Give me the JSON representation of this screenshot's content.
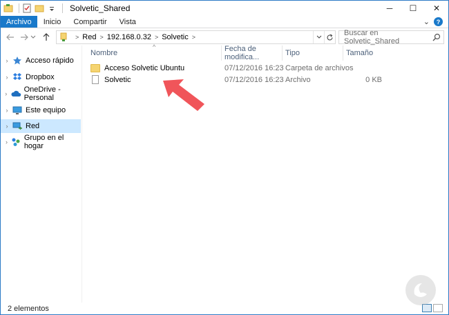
{
  "window": {
    "title": "Solvetic_Shared",
    "controls": {
      "minimize": "─",
      "maximize": "☐",
      "close": "✕"
    }
  },
  "ribbon": {
    "tabs": [
      "Archivo",
      "Inicio",
      "Compartir",
      "Vista"
    ],
    "expand_glyph": "⌄",
    "help_glyph": "?"
  },
  "address": {
    "crumbs": [
      "Red",
      "192.168.0.32",
      "Solvetic"
    ],
    "separator": ">"
  },
  "search": {
    "placeholder": "Buscar en Solvetic_Shared"
  },
  "nav": {
    "items": [
      {
        "label": "Acceso rápido",
        "icon": "star-icon"
      },
      {
        "label": "Dropbox",
        "icon": "dropbox-icon"
      },
      {
        "label": "OneDrive - Personal",
        "icon": "cloud-icon"
      },
      {
        "label": "Este equipo",
        "icon": "computer-icon"
      },
      {
        "label": "Red",
        "icon": "network-icon",
        "selected": true
      },
      {
        "label": "Grupo en el hogar",
        "icon": "homegroup-icon"
      }
    ]
  },
  "columns": {
    "name": "Nombre",
    "date": "Fecha de modifica...",
    "type": "Tipo",
    "size": "Tamaño"
  },
  "files": [
    {
      "name": "Acceso Solvetic Ubuntu",
      "date": "07/12/2016 16:23",
      "type": "Carpeta de archivos",
      "size": "",
      "kind": "folder"
    },
    {
      "name": "Solvetic",
      "date": "07/12/2016 16:23",
      "type": "Archivo",
      "size": "0 KB",
      "kind": "file"
    }
  ],
  "status": {
    "count": "2 elementos"
  },
  "colors": {
    "accent": "#1979ca",
    "selection": "#cce8ff",
    "arrow": "#f0555a"
  }
}
